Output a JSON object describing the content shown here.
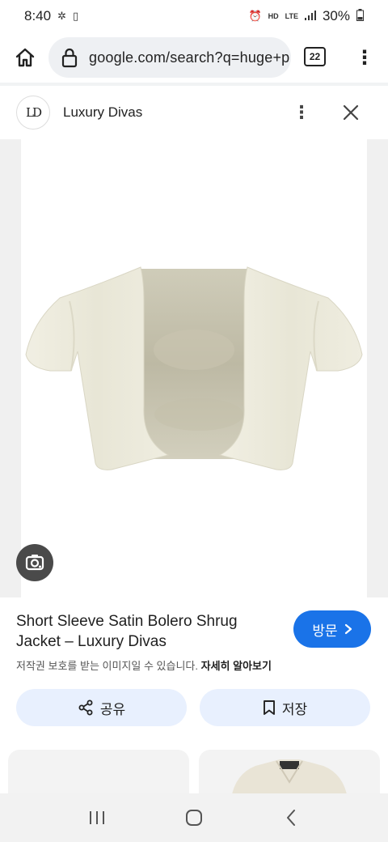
{
  "status_bar": {
    "time": "8:40",
    "battery": "30%",
    "network": "LTE"
  },
  "browser": {
    "url": "google.com/search?q=huge+p",
    "tab_count": "22"
  },
  "source": {
    "logo_text": "LD",
    "name": "Luxury Divas"
  },
  "result": {
    "title": "Short Sleeve Satin Bolero Shrug Jacket – Luxury Divas",
    "visit_label": "방문",
    "copyright_text": "저작권 보호를 받는 이미지일 수 있습니다.",
    "learn_more": "자세히 알아보기"
  },
  "actions": {
    "share_label": "공유",
    "save_label": "저장"
  },
  "colors": {
    "accent": "#1a73e8",
    "chip_bg": "#e8f0fe",
    "garment": "#ecead9"
  }
}
